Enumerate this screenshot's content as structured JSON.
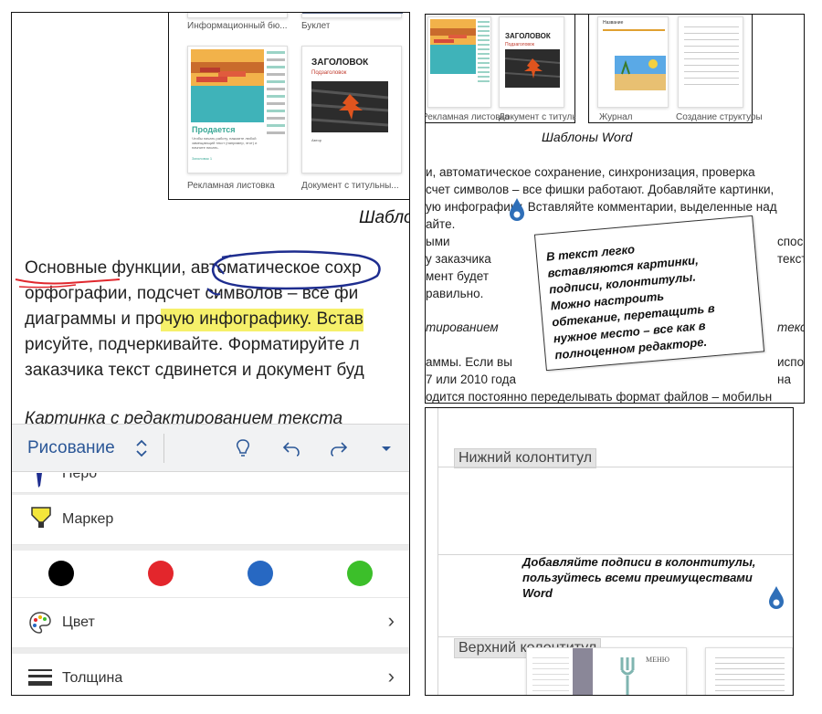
{
  "left": {
    "template_captions": [
      "Информационный бю...",
      "Буклет",
      "Рекламная листовка",
      "Документ с титульны..."
    ],
    "thumb1": {
      "heading": "Продается",
      "body": "Чтобы начать работу, нажмите любой замещающий текст (например, этот) и начните писать.",
      "footer": "Заголовок 1"
    },
    "thumb2": {
      "title": "ЗАГОЛОВОК",
      "subtitle": "Подзаголовок",
      "footer": "Автор"
    },
    "caption_partial": "Шабло",
    "paragraph": [
      "Основные функции, автоматическое сохр",
      "орфографии, подсчет символов – все фи",
      "диаграммы и прочую инфографику. Встав",
      "рисуйте, подчеркивайте. Форматируйте л",
      "заказчика текст сдвинется и документ буд"
    ],
    "highlight": "прочую инфографику.",
    "italic_partial": "Картинка с редактированием текста",
    "toolbar": {
      "title": "Рисование"
    },
    "menu": {
      "pen": "Перо",
      "marker": "Маркер",
      "color": "Цвет",
      "thickness": "Толщина"
    },
    "swatch_colors": [
      "#000000",
      "#e3262c",
      "#2768c2",
      "#3cbf2a"
    ]
  },
  "top_right": {
    "thumb_captions": [
      "Рекламная листовка",
      "Документ с титульны...",
      "Журнал",
      "Создание структуры"
    ],
    "thumb2": {
      "title": "ЗАГОЛОВОК",
      "subtitle": "Подзаголовок"
    },
    "thumb3": {
      "title": "Название"
    },
    "caption": "Шаблоны Word",
    "lines": [
      "и, автоматическое сохранение, синхронизация, проверка",
      "счет символов – все фишки работают. Добавляйте картинки,",
      "ую инфографику. Вставляйте комментарии, выделенные над",
      "айте."
    ],
    "fragments": [
      "ыми",
      "спос",
      "у заказчика",
      "текст",
      "мент будет",
      "равильно.",
      "тированием",
      "текс",
      "аммы. Если вы",
      "испо",
      "7 или 2010 года",
      "на"
    ],
    "last_line": "одится постоянно переделывать формат файлов – мобильн",
    "callout": "В текст легко\nвставляются картинки,\nподписи, колонтитулы.\nМожно настроить\nобтекание, перетащить в\nнужное место – все как в\nполноценном редакторе."
  },
  "bottom_right": {
    "footer_label": "Нижний колонтитул",
    "header_label": "Верхний колонтитул",
    "note": "Добавляйте подписи в колонтитулы,\nпользуйтесь всеми преимуществами\nWord",
    "menu_thumb": "МЕНЮ"
  }
}
